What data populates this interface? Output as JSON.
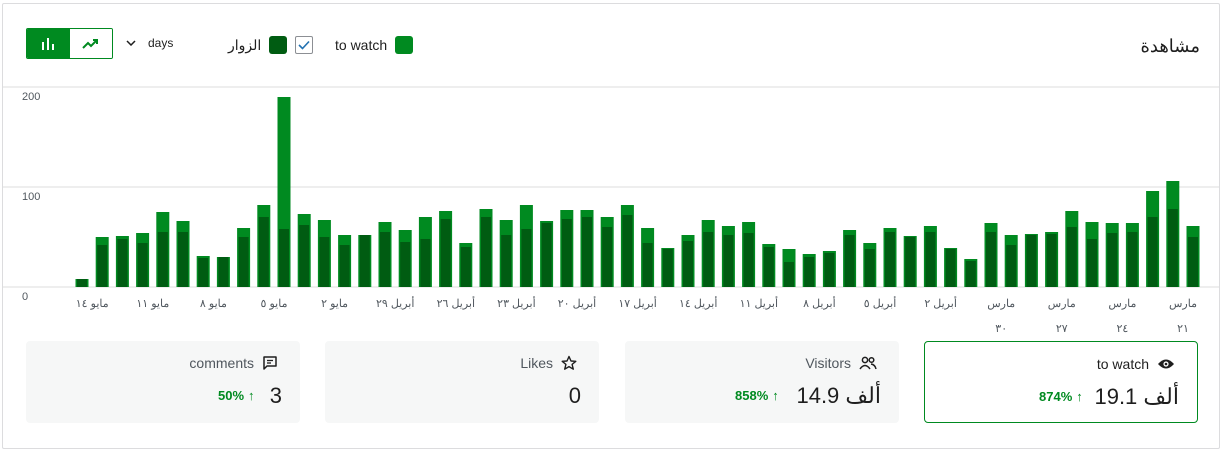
{
  "header": {
    "title": "مشاهدة"
  },
  "legend": {
    "views_label": "to watch",
    "visitors_label": "الزوار"
  },
  "period": {
    "selected": "days"
  },
  "colors": {
    "views": "#008a20",
    "visitors": "#005c12",
    "axis": "#dcdcde",
    "accent": "#008a20"
  },
  "chart_data": {
    "type": "bar",
    "ylim": [
      0,
      200
    ],
    "y_ticks": [
      "0",
      "100",
      "200"
    ],
    "x_tick_labels": [
      {
        "index": 0,
        "line1": "مارس",
        "line2": "٢١"
      },
      {
        "index": 3,
        "line1": "مارس",
        "line2": "٢٤"
      },
      {
        "index": 6,
        "line1": "مارس",
        "line2": "٢٧"
      },
      {
        "index": 9,
        "line1": "مارس",
        "line2": "٣٠"
      },
      {
        "index": 12,
        "line1": "أبريل ٢",
        "line2": ""
      },
      {
        "index": 15,
        "line1": "أبريل ٥",
        "line2": ""
      },
      {
        "index": 18,
        "line1": "أبريل ٨",
        "line2": ""
      },
      {
        "index": 21,
        "line1": "أبريل ١١",
        "line2": ""
      },
      {
        "index": 24,
        "line1": "أبريل ١٤",
        "line2": ""
      },
      {
        "index": 27,
        "line1": "أبريل ١٧",
        "line2": ""
      },
      {
        "index": 30,
        "line1": "أبريل ٢٠",
        "line2": ""
      },
      {
        "index": 33,
        "line1": "أبريل ٢٣",
        "line2": ""
      },
      {
        "index": 36,
        "line1": "أبريل ٢٦",
        "line2": ""
      },
      {
        "index": 39,
        "line1": "أبريل ٢٩",
        "line2": ""
      },
      {
        "index": 42,
        "line1": "مايو ٢",
        "line2": ""
      },
      {
        "index": 45,
        "line1": "مايو ٥",
        "line2": ""
      },
      {
        "index": 48,
        "line1": "مايو ٨",
        "line2": ""
      },
      {
        "index": 51,
        "line1": "مايو ١١",
        "line2": ""
      },
      {
        "index": 54,
        "line1": "مايو ١٤",
        "line2": ""
      }
    ],
    "series": [
      {
        "name": "to watch",
        "values": [
          61,
          106,
          96,
          64,
          64,
          65,
          76,
          55,
          53,
          52,
          64,
          28,
          39,
          61,
          51,
          59,
          44,
          57,
          36,
          33,
          38,
          43,
          65,
          61,
          67,
          52,
          39,
          59,
          82,
          70,
          77,
          77,
          66,
          82,
          67,
          78,
          44,
          76,
          70,
          57,
          65,
          52,
          52,
          67,
          73,
          190,
          82,
          59,
          30,
          31,
          66,
          75,
          54,
          51,
          50,
          8
        ]
      },
      {
        "name": "الزوار",
        "values": [
          50,
          78,
          70,
          55,
          54,
          48,
          60,
          53,
          52,
          42,
          55,
          26,
          38,
          55,
          50,
          55,
          38,
          52,
          34,
          30,
          25,
          40,
          54,
          52,
          55,
          46,
          38,
          44,
          72,
          60,
          70,
          68,
          64,
          58,
          52,
          70,
          40,
          68,
          48,
          45,
          55,
          52,
          42,
          50,
          62,
          58,
          70,
          50,
          30,
          29,
          55,
          55,
          44,
          48,
          42,
          8
        ]
      }
    ]
  },
  "cards": [
    {
      "label": "to watch",
      "value": "19.1 ألف",
      "delta": "874%",
      "arrow": "↑",
      "icon": "eye-icon"
    },
    {
      "label": "Visitors",
      "value": "14.9 ألف",
      "delta": "858%",
      "arrow": "↑",
      "icon": "people-icon"
    },
    {
      "label": "Likes",
      "value": "0",
      "delta": "",
      "arrow": "",
      "icon": "star-icon"
    },
    {
      "label": "comments",
      "value": "3",
      "delta": "50%",
      "arrow": "↑",
      "icon": "comment-icon"
    }
  ]
}
